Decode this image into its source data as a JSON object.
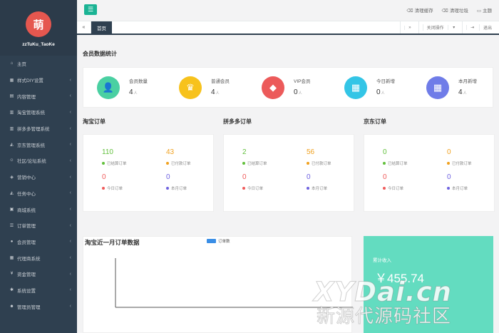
{
  "sidebar": {
    "avatar_text": "萌",
    "brand": "zzTuKu_TaoKe",
    "items": [
      {
        "label": "主页",
        "icon": "home-icon",
        "glyph": "⌂",
        "chevron": false
      },
      {
        "label": "样式DIY设置",
        "icon": "grid-icon",
        "glyph": "▦",
        "chevron": true
      },
      {
        "label": "内容管理",
        "icon": "document-icon",
        "glyph": "▤",
        "chevron": true
      },
      {
        "label": "淘宝管理系统",
        "icon": "bar-chart-icon",
        "glyph": "▥",
        "chevron": true
      },
      {
        "label": "拼多多管理系统",
        "icon": "bar-chart-icon",
        "glyph": "▥",
        "chevron": true
      },
      {
        "label": "京东管理系统",
        "icon": "area-chart-icon",
        "glyph": "◭",
        "chevron": true
      },
      {
        "label": "社区/论坛系统",
        "icon": "users-icon",
        "glyph": "☺",
        "chevron": true
      },
      {
        "label": "营销中心",
        "icon": "bullhorn-icon",
        "glyph": "◈",
        "chevron": true
      },
      {
        "label": "任务中心",
        "icon": "area-chart-icon",
        "glyph": "◭",
        "chevron": true
      },
      {
        "label": "商城系统",
        "icon": "cart-icon",
        "glyph": "▣",
        "chevron": true
      },
      {
        "label": "订单管理",
        "icon": "list-icon",
        "glyph": "☰",
        "chevron": true
      },
      {
        "label": "会员管理",
        "icon": "user-icon",
        "glyph": "●",
        "chevron": true
      },
      {
        "label": "代理商系统",
        "icon": "sitemap-icon",
        "glyph": "▦",
        "chevron": true
      },
      {
        "label": "资金管理",
        "icon": "yen-icon",
        "glyph": "¥",
        "chevron": true
      },
      {
        "label": "系统设置",
        "icon": "gear-icon",
        "glyph": "✱",
        "chevron": true
      },
      {
        "label": "管理员管理",
        "icon": "admin-icon",
        "glyph": "☻",
        "chevron": true
      }
    ]
  },
  "topbar": {
    "menu_icon": "☰",
    "clear_cache": "清理缓存",
    "clear_trash": "清理垃圾",
    "theme": "主题"
  },
  "tabs": {
    "home": "首页",
    "close_ops": "关闭操作",
    "logout": "退出"
  },
  "stats": {
    "title": "会员数据统计",
    "unit": "人",
    "items": [
      {
        "label": "会员数量",
        "value": "4",
        "color": "#4ad0a2",
        "icon": "user-icon",
        "glyph": "👤"
      },
      {
        "label": "普通会员",
        "value": "4",
        "color": "#f7c21c",
        "icon": "crown-icon",
        "glyph": "♛"
      },
      {
        "label": "VIP会员",
        "value": "0",
        "color": "#ec5a5a",
        "icon": "diamond-icon",
        "glyph": "◆"
      },
      {
        "label": "今日新增",
        "value": "0",
        "color": "#33c5e6",
        "icon": "calendar-check-icon",
        "glyph": "▦"
      },
      {
        "label": "本月新增",
        "value": "4",
        "color": "#6f7ce8",
        "icon": "calendar-check-icon",
        "glyph": "▦"
      }
    ]
  },
  "orders": [
    {
      "title": "淘宝订单",
      "settled": "110",
      "paid": "43",
      "today": "0",
      "month": "0"
    },
    {
      "title": "拼多多订单",
      "settled": "2",
      "paid": "56",
      "today": "0",
      "month": "0"
    },
    {
      "title": "京东订单",
      "settled": "0",
      "paid": "0",
      "today": "0",
      "month": "0"
    }
  ],
  "order_labels": {
    "settled": "已结算订单",
    "paid": "已付款订单",
    "today": "今日订单",
    "month": "本月订单"
  },
  "order_colors": {
    "settled": "#62c03c",
    "paid": "#f0a11f",
    "today": "#ef5b5b",
    "month": "#6f63e0"
  },
  "chart": {
    "title": "淘宝近一月订单数据",
    "legend": "订单数",
    "legend_color": "#3a8ee6"
  },
  "chart_data": {
    "type": "line",
    "series": [
      {
        "name": "订单数",
        "values": []
      }
    ],
    "x": []
  },
  "revenue": {
    "label": "累计收入",
    "value": "￥455.74"
  },
  "watermark": {
    "line1": "XYDai.cn",
    "line2": "新源代源码社区"
  }
}
